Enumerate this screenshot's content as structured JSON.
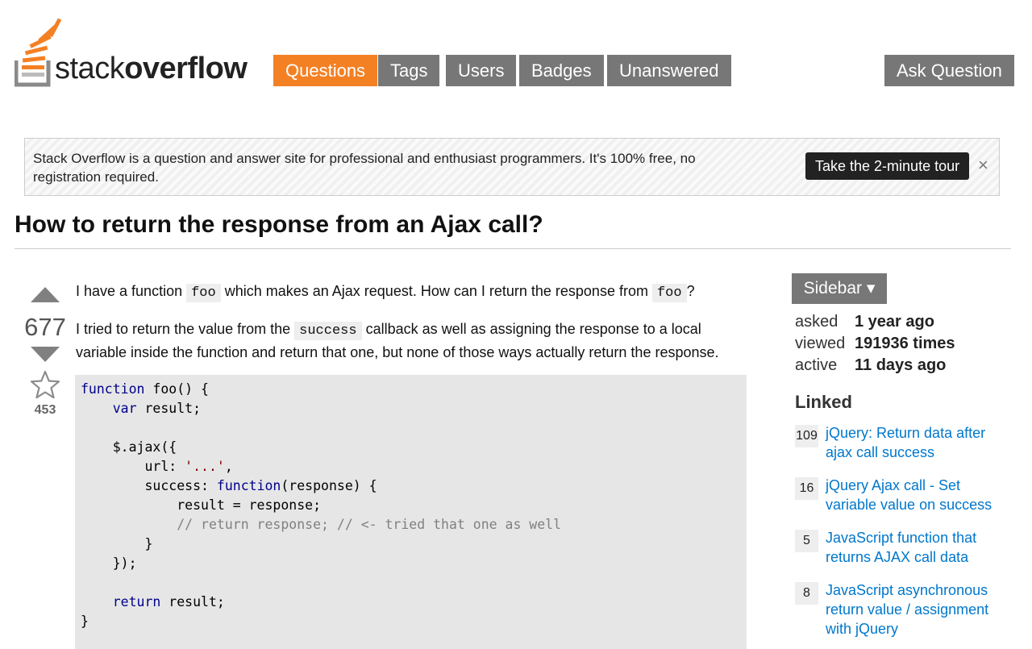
{
  "header": {
    "logo_text_light": "stack",
    "logo_text_bold": "overflow",
    "nav": [
      {
        "label": "Questions",
        "active": true
      },
      {
        "label": "Tags",
        "active": false
      },
      {
        "label": "Users",
        "active": false
      },
      {
        "label": "Badges",
        "active": false
      },
      {
        "label": "Unanswered",
        "active": false
      }
    ],
    "ask_button": "Ask Question"
  },
  "notice": {
    "text": "Stack Overflow is a question and answer site for professional and enthusiast programmers. It's 100% free, no registration required.",
    "tour_button": "Take the 2-minute tour",
    "close": "×"
  },
  "question": {
    "title": "How to return the response from an Ajax call?",
    "votes": "677",
    "favorites": "453",
    "para1": {
      "t1": "I have a function ",
      "c1": "foo",
      "t2": " which makes an Ajax request. How can I return the response from ",
      "c2": "foo",
      "t3": "?"
    },
    "para2": {
      "t1": "I tried to return the value from the ",
      "c1": "success",
      "t2": " callback as well as assigning the response to a local variable inside the function and return that one, but none of those ways actually return the response."
    },
    "code": {
      "l1_kw": "function",
      "l1_rest": " foo() {",
      "l2_kw": "var",
      "l2_rest": " result;",
      "l4": "$.ajax({",
      "l5_a": "url: ",
      "l5_str": "'...'",
      "l5_b": ",",
      "l6_a": "success: ",
      "l6_kw": "function",
      "l6_b": "(response) {",
      "l7": "result = response;",
      "l8_com": "// return response; // <- tried that one as well",
      "l9": "}",
      "l10": "});",
      "l12_kw": "return",
      "l12_rest": " result;",
      "l13": "}"
    }
  },
  "sidebar": {
    "button": "Sidebar ▾",
    "stats": [
      {
        "label": "asked",
        "value": "1 year ago"
      },
      {
        "label": "viewed",
        "value": "191936 times"
      },
      {
        "label": "active",
        "value": "11 days ago"
      }
    ],
    "linked_heading": "Linked",
    "linked": [
      {
        "score": "109",
        "title": "jQuery: Return data after ajax call success"
      },
      {
        "score": "16",
        "title": "jQuery Ajax call - Set variable value on success"
      },
      {
        "score": "5",
        "title": "JavaScript function that returns AJAX call data"
      },
      {
        "score": "8",
        "title": "JavaScript asynchronous return value / assignment with jQuery"
      }
    ]
  },
  "colors": {
    "accent": "#f48024",
    "nav_gray": "#777777",
    "link": "#0077cc"
  },
  "icons": [
    "stack-logo-icon",
    "upvote-arrow-icon",
    "downvote-arrow-icon",
    "favorite-star-icon",
    "close-icon",
    "dropdown-caret-icon"
  ]
}
